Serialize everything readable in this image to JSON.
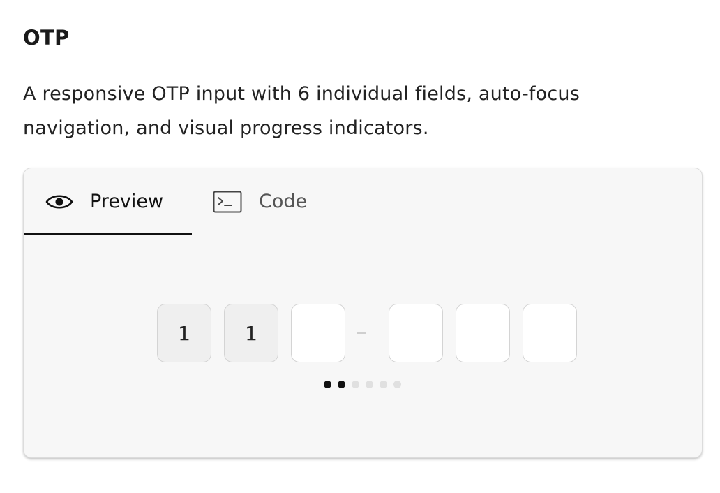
{
  "page": {
    "title": "OTP",
    "description": "A responsive OTP input with 6 individual fields, auto-focus navigation, and visual progress indicators."
  },
  "tabs": [
    {
      "label": "Preview",
      "icon": "eye-icon",
      "active": true
    },
    {
      "label": "Code",
      "icon": "terminal-icon",
      "active": false
    }
  ],
  "otp": {
    "fields": [
      "1",
      "1",
      "",
      "",
      "",
      ""
    ],
    "filled_count": 2,
    "total": 6,
    "separator": "–"
  },
  "progress": {
    "filled": 2,
    "total": 6
  },
  "colors": {
    "active": "#111111",
    "inactive_dot": "#e0e0e0",
    "filled_field_bg": "#efefef",
    "card_bg": "#f7f7f7"
  }
}
